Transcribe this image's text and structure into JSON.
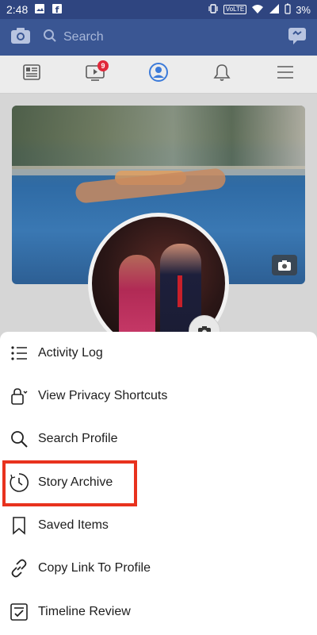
{
  "status_bar": {
    "time": "2:48",
    "network": "VoLTE",
    "battery": "3%"
  },
  "top_bar": {
    "search_placeholder": "Search"
  },
  "tabs": {
    "items": [
      {
        "name": "news-feed-icon"
      },
      {
        "name": "watch-icon",
        "badge": "9"
      },
      {
        "name": "profile-icon",
        "active": true
      },
      {
        "name": "notifications-icon"
      },
      {
        "name": "menu-icon"
      }
    ]
  },
  "menu": {
    "items": [
      {
        "label": "Activity Log",
        "icon": "list-icon"
      },
      {
        "label": "View Privacy Shortcuts",
        "icon": "lock-icon"
      },
      {
        "label": "Search Profile",
        "icon": "search-icon"
      },
      {
        "label": "Story Archive",
        "icon": "clock-archive-icon",
        "highlighted": true
      },
      {
        "label": "Saved Items",
        "icon": "bookmark-icon"
      },
      {
        "label": "Copy Link To Profile",
        "icon": "link-icon"
      },
      {
        "label": "Timeline Review",
        "icon": "review-icon"
      }
    ]
  },
  "colors": {
    "brand": "#3a5693",
    "status_bar": "#2f4580",
    "active_tab": "#3b7ad9",
    "badge": "#e0283a",
    "highlight": "#e8321e"
  }
}
